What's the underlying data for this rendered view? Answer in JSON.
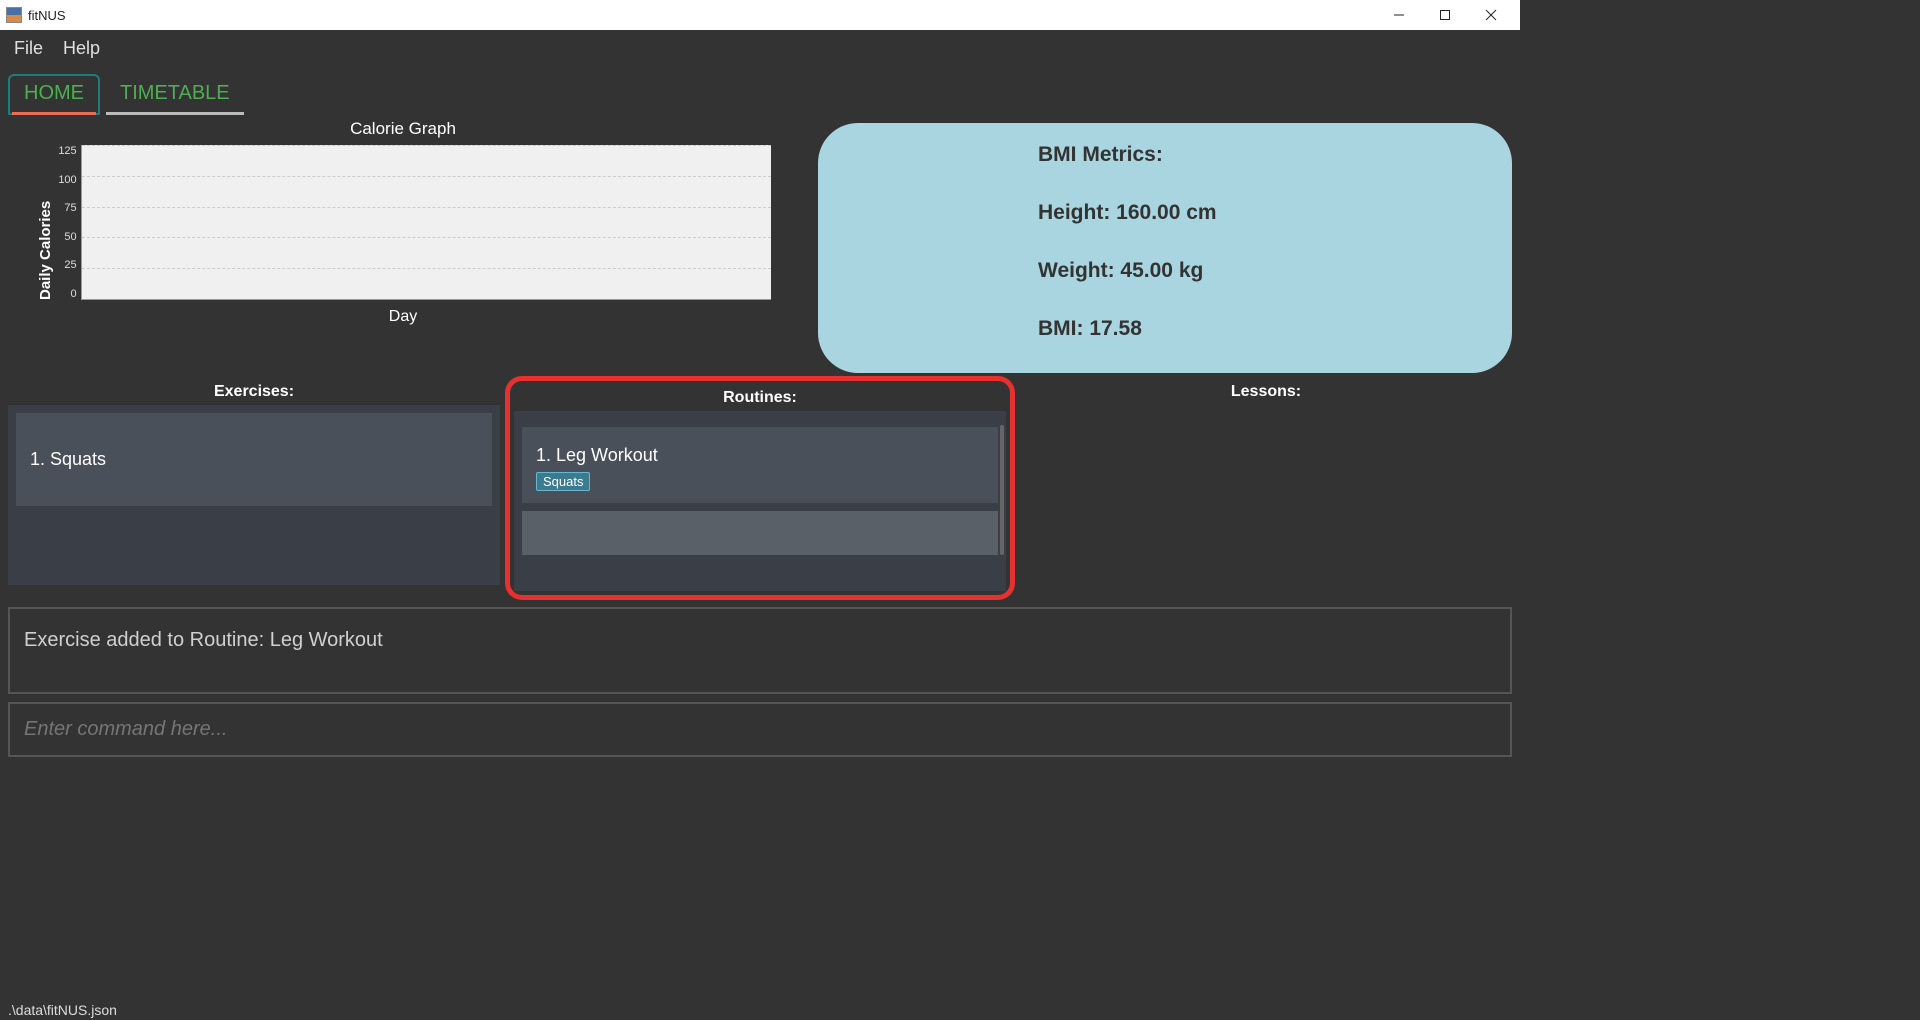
{
  "window": {
    "title": "fitNUS"
  },
  "menu": {
    "file": "File",
    "help": "Help"
  },
  "tabs": {
    "home": "HOME",
    "timetable": "TIMETABLE"
  },
  "chart": {
    "title": "Calorie Graph",
    "ylabel": "Daily Calories",
    "xlabel": "Day",
    "yticks": [
      "125",
      "100",
      "75",
      "50",
      "25",
      "0"
    ]
  },
  "chart_data": {
    "type": "line",
    "title": "Calorie Graph",
    "xlabel": "Day",
    "ylabel": "Daily Calories",
    "ylim": [
      0,
      125
    ],
    "categories": [],
    "values": []
  },
  "bmi": {
    "header": "BMI Metrics:",
    "height": "Height: 160.00 cm",
    "weight": "Weight: 45.00 kg",
    "bmi": "BMI: 17.58"
  },
  "lists": {
    "exercises_header": "Exercises:",
    "routines_header": "Routines:",
    "lessons_header": "Lessons:",
    "exercises": [
      {
        "label": "1.  Squats"
      }
    ],
    "routines": [
      {
        "title": "1.  Leg Workout",
        "tag": "Squats"
      }
    ]
  },
  "message": "Exercise added to Routine: Leg Workout",
  "command": {
    "placeholder": "Enter command here..."
  },
  "statusbar": ".\\data\\fitNUS.json"
}
